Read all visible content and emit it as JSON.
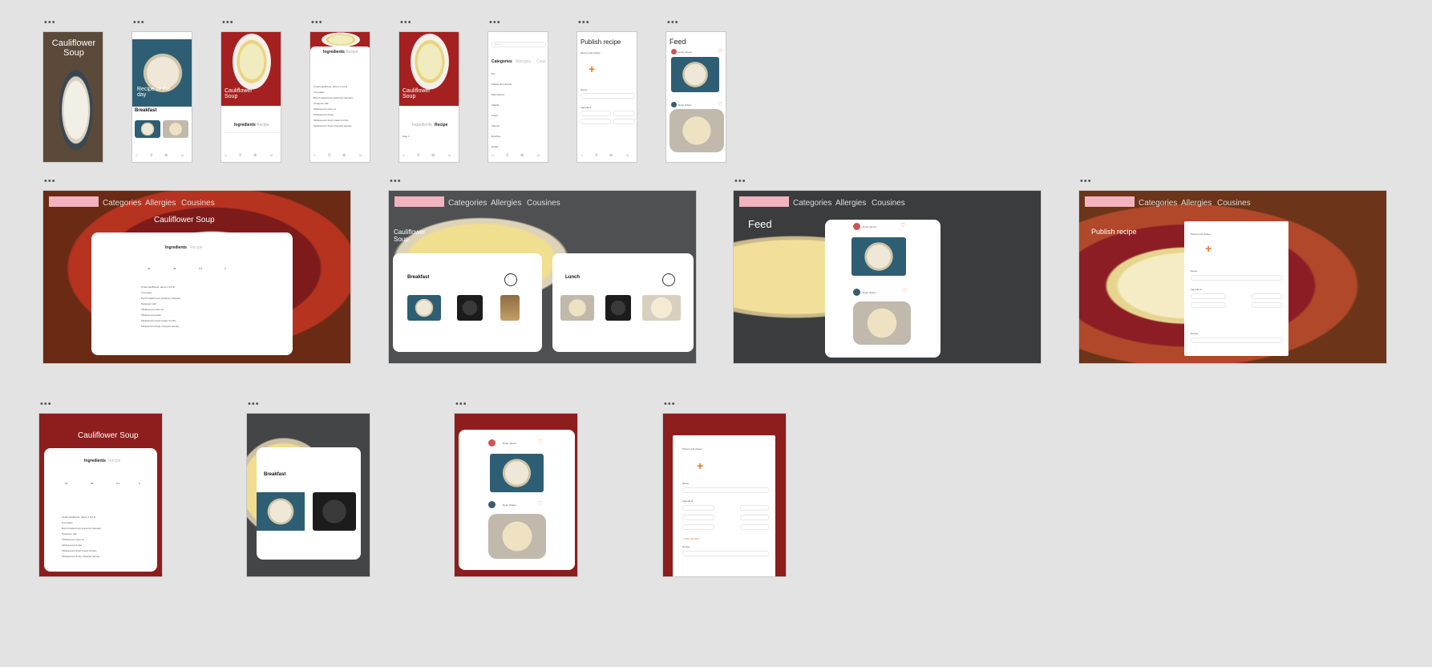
{
  "frame_dots": "•••",
  "mobile": {
    "splash_title": "Cauliflower Soup",
    "recipe_of_day": "Recipe of the day",
    "breakfast_label": "Breakfast",
    "soup_title": "Cauliflower Soup",
    "tab_ingredients": "Ingredients",
    "tab_recipe": "Recipe",
    "search_placeholder": "Search",
    "categories_tabs": [
      "Categories",
      "Allergies",
      "Cous"
    ],
    "category_list": [
      "Dry",
      "Pastas and breads",
      "Main dishes",
      "Salads",
      "Soups",
      "Sauces",
      "Brodhos",
      "Drinks"
    ],
    "publish_title": "Publish recipe",
    "photos_label": "Photos and videos",
    "name_label": "Name",
    "ingredients_label": "Ingredient",
    "feed_title": "Feed",
    "user_1": "Emily James",
    "user_2": "Ryan Odeon",
    "step_label": "Step 1"
  },
  "desktop": {
    "nav_items": [
      "Categories",
      "Allergies",
      "Cousines"
    ],
    "soup_title": "Cauliflower Soup",
    "tab_ingredients": "Ingredients",
    "tab_recipe": "Recipe",
    "soup_title_2": "Cauliflower Soup",
    "breakfast": "Breakfast",
    "lunch": "Lunch",
    "feed_title": "Feed",
    "user_1": "Emily James",
    "user_2": "Ryan Odeon",
    "publish_title": "Publish recipe",
    "photos_label": "Photos and videos",
    "name_label": "Name",
    "ingredient_label": "Ingredient",
    "recipe_label": "Recipe"
  },
  "tablet": {
    "soup_title": "Cauliflower Soup",
    "tab_ingredients": "Ingredients",
    "tab_recipe": "Recipe",
    "breakfast": "Breakfast",
    "user_1": "Emily James",
    "user_2": "Ryan Odeon",
    "photos_label": "Photos and videos",
    "name_label": "Name",
    "ingredient_label": "Ingredient",
    "add_ingredient": "+ add ingredient",
    "recipe_label": "Recipe"
  },
  "ingredients": [
    "Small cauliflower, about 1 1/2 lb",
    "Cup water",
    "Bunch watercress (parsnip) chopped",
    "Teaspoon salt",
    "Tablespoons olive oil",
    "Tablespoons butter",
    "Tablespoons fresh bread crumbs",
    "Tablespoons finely chopped parsley"
  ],
  "nutrition": [
    {
      "label": "Calories",
      "value": "30"
    },
    {
      "label": "Protein",
      "value": "38"
    },
    {
      "label": "Fat",
      "value": "8.4"
    },
    {
      "label": "Carbs",
      "value": "9"
    }
  ]
}
